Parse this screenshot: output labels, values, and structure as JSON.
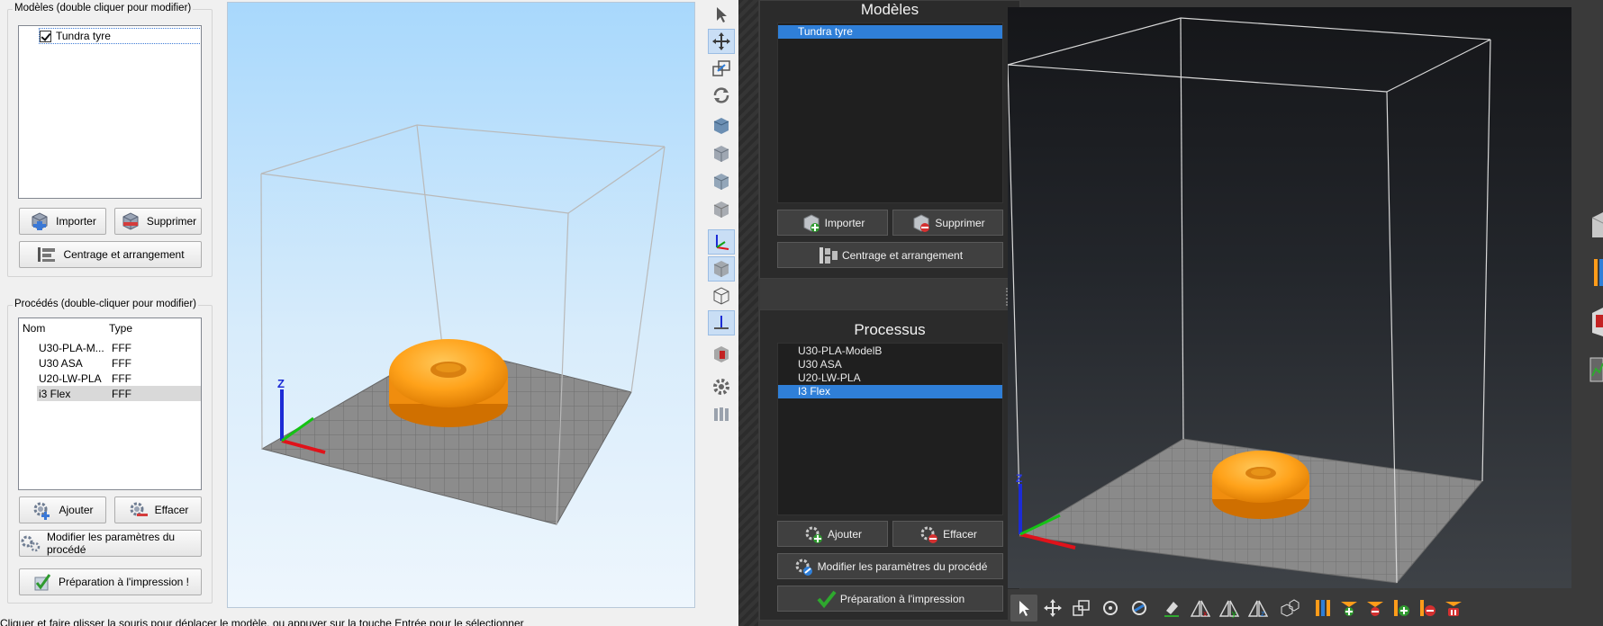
{
  "light": {
    "models_group_title": "Modèles (double cliquer pour modifier)",
    "models": [
      {
        "name": "Tundra tyre",
        "checked": true
      }
    ],
    "import_label": "Importer",
    "delete_label": "Supprimer",
    "arrange_label": "Centrage et arrangement",
    "process_group_title": "Procédés (double-cliquer pour modifier)",
    "process_columns": {
      "name": "Nom",
      "type": "Type"
    },
    "processes": [
      {
        "name": "U30-PLA-M...",
        "type": "FFF"
      },
      {
        "name": "U30 ASA",
        "type": "FFF"
      },
      {
        "name": "U20-LW-PLA",
        "type": "FFF"
      },
      {
        "name": "i3 Flex",
        "type": "FFF",
        "selected": true
      }
    ],
    "add_label": "Ajouter",
    "erase_label": "Effacer",
    "edit_process_label": "Modifier les paramètres du procédé",
    "prepare_label": "Préparation à l'impression !",
    "status_text": "Cliquer et faire glisser la souris pour déplacer le modèle, ou appuyer sur la touche Entrée pour le sélectionner",
    "axis_label": "Z"
  },
  "dark": {
    "models_title": "Modèles",
    "models": [
      {
        "name": "Tundra tyre",
        "selected": true
      }
    ],
    "import_label": "Importer",
    "delete_label": "Supprimer",
    "arrange_label": "Centrage et arrangement",
    "process_title": "Processus",
    "processes": [
      {
        "name": "U30-PLA-ModelB"
      },
      {
        "name": "U30 ASA"
      },
      {
        "name": "U20-LW-PLA"
      },
      {
        "name": "I3 Flex",
        "selected": true
      }
    ],
    "add_label": "Ajouter",
    "erase_label": "Effacer",
    "edit_process_label": "Modifier les paramètres du procédé",
    "prepare_label": "Préparation à l'impression",
    "axis_label": "Z"
  },
  "colors": {
    "selection_blue": "#2f7fd8",
    "model_orange": "#ffa21a",
    "light_sky": "#a8d8fc",
    "dark_bg": "#2b2b2b"
  }
}
